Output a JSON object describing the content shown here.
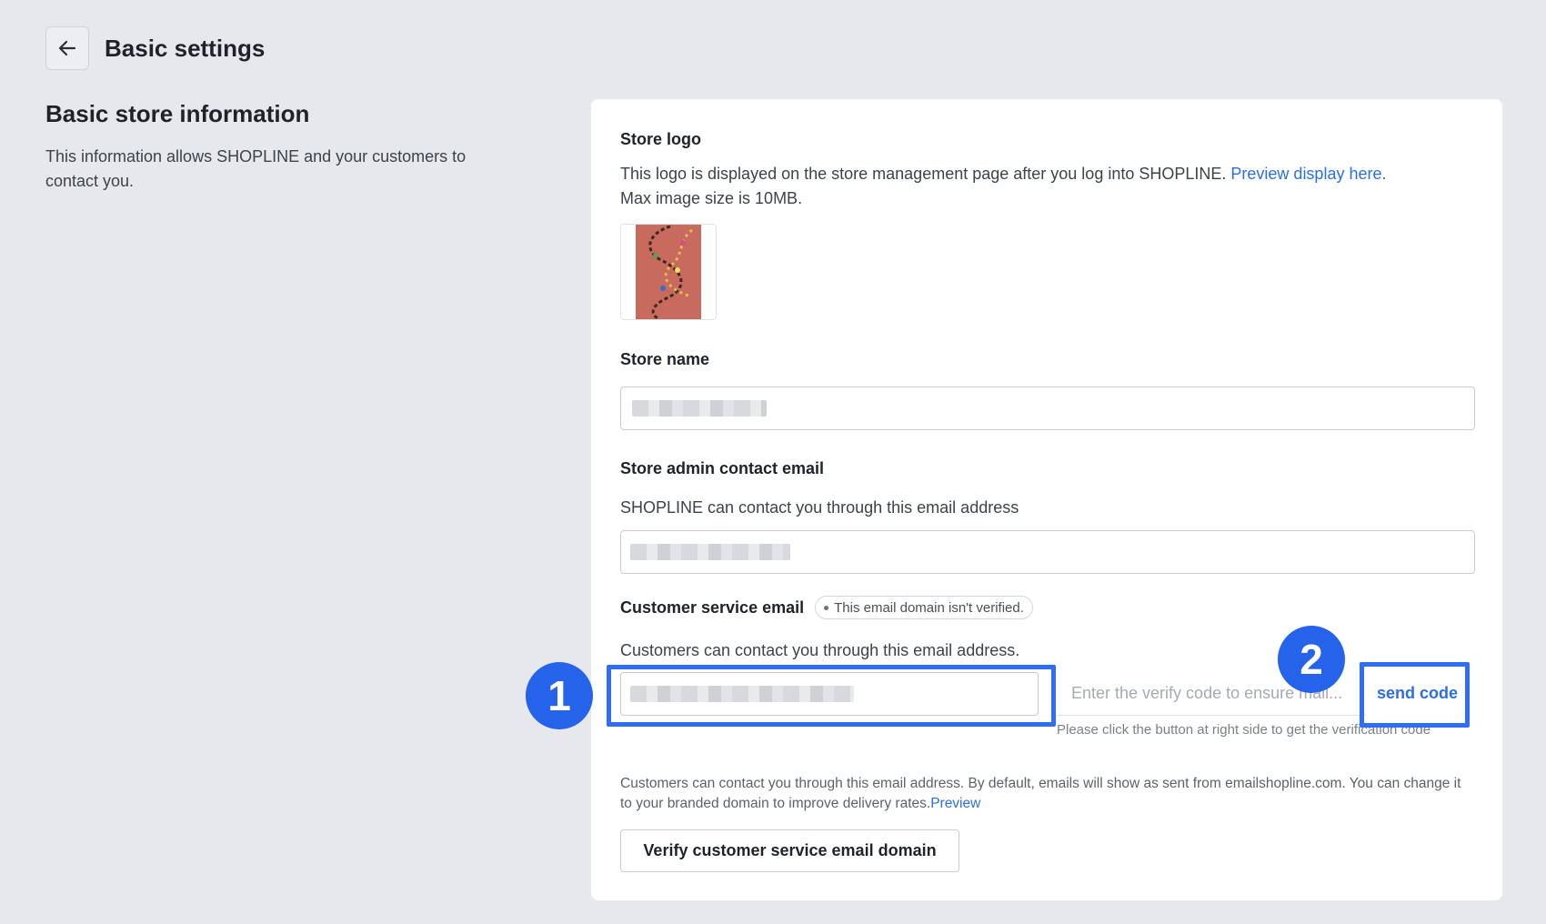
{
  "header": {
    "title": "Basic settings"
  },
  "section": {
    "title": "Basic store information",
    "description": "This information allows SHOPLINE and your customers to contact you."
  },
  "store_logo": {
    "label": "Store logo",
    "description_prefix": "This logo is displayed on the store management page after you log into SHOPLINE.",
    "preview_link": "Preview display here.",
    "description_suffix": "Max image size is 10MB."
  },
  "store_name": {
    "label": "Store name"
  },
  "admin_email": {
    "label": "Store admin contact email",
    "description": "SHOPLINE can contact you through this email address"
  },
  "customer_email": {
    "label": "Customer service email",
    "badge": "This email domain isn't verified.",
    "description": "Customers can contact you through this email address.",
    "verify_placeholder": "Enter the verify code to ensure mail...",
    "send_code": "send code",
    "hint": "Please click the button at right side to get the verification code",
    "footer_text": "Customers can contact you through this email address. By default, emails will show as sent from emailshopline.com. You can change it to your branded domain to improve delivery rates.",
    "footer_link": "Preview",
    "verify_button": "Verify customer service email domain"
  },
  "annotations": {
    "marker_1": "1",
    "marker_2": "2"
  },
  "colors": {
    "accent": "#2b6fe0",
    "highlight": "#2f6df6",
    "background": "#e6e8ec"
  },
  "icons": {
    "back": "arrow-left-icon"
  }
}
